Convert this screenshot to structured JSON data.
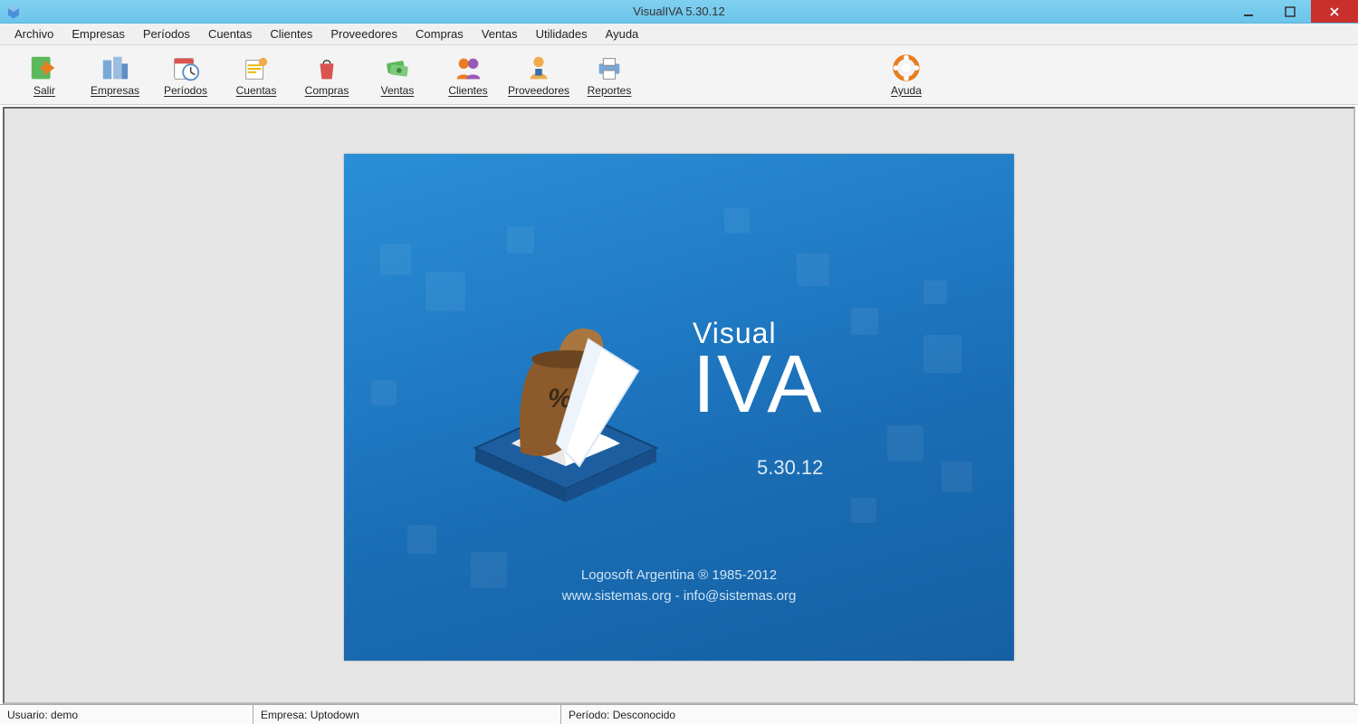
{
  "window": {
    "title": "VisualIVA 5.30.12"
  },
  "menu": {
    "items": [
      "Archivo",
      "Empresas",
      "Períodos",
      "Cuentas",
      "Clientes",
      "Proveedores",
      "Compras",
      "Ventas",
      "Utilidades",
      "Ayuda"
    ]
  },
  "toolbar": {
    "salir": "Salir",
    "empresas": "Empresas",
    "periodos": "Períodos",
    "cuentas": "Cuentas",
    "compras": "Compras",
    "ventas": "Ventas",
    "clientes": "Clientes",
    "proveedores": "Proveedores",
    "reportes": "Reportes",
    "ayuda": "Ayuda"
  },
  "splash": {
    "title_line1": "Visual",
    "title_line2": "IVA",
    "version": "5.30.12",
    "copyright": "Logosoft Argentina ® 1985-2012",
    "contact": "www.sistemas.org - info@sistemas.org"
  },
  "status": {
    "user_label": "Usuario:",
    "user_value": "demo",
    "company_label": "Empresa:",
    "company_value": "Uptodown",
    "period_label": "Período:",
    "period_value": "Desconocido"
  }
}
